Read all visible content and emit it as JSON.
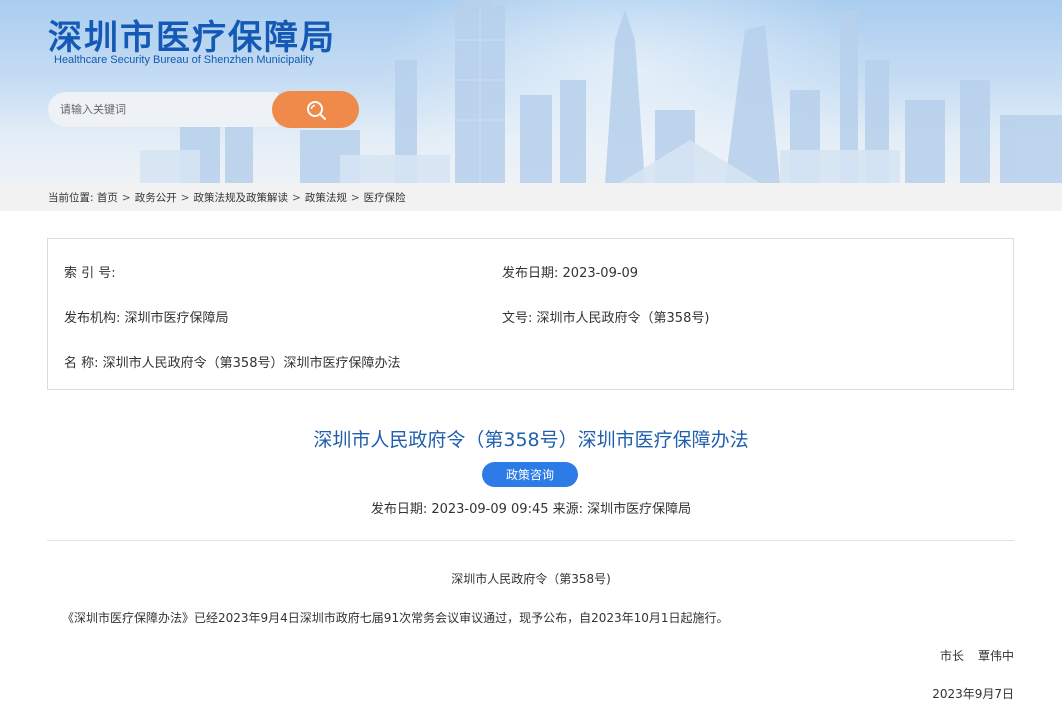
{
  "header": {
    "title": "深圳市医疗保障局",
    "subtitle": "Healthcare Security Bureau of Shenzhen Municipality",
    "search_placeholder": "请输入关键词"
  },
  "breadcrumb": {
    "prefix": "当前位置:",
    "items": [
      "首页",
      "政务公开",
      "政策法规及政策解读",
      "政策法规",
      "医疗保险"
    ],
    "separator": ">"
  },
  "info": {
    "index_label": "索 引 号:",
    "index_value": "",
    "date_label": "发布日期:",
    "date_value": "2023-09-09",
    "org_label": "发布机构:",
    "org_value": "深圳市医疗保障局",
    "doc_no_label": "文号:",
    "doc_no_value": "深圳市人民政府令（第358号)",
    "name_label": "名 称:",
    "name_value": "深圳市人民政府令（第358号）深圳市医疗保障办法"
  },
  "article": {
    "title": "深圳市人民政府令（第358号）深圳市医疗保障办法",
    "tag_button": "政策咨询",
    "meta_date_label": "发布日期:",
    "meta_date_value": "2023-09-09 09:45",
    "meta_source_label": "来源:",
    "meta_source_value": "深圳市医疗保障局",
    "decree_heading": "深圳市人民政府令（第358号)",
    "decree_text": "《深圳市医疗保障办法》已经2023年9月4日深圳市政府七届91次常务会议审议通过，现予公布，自2023年10月1日起施行。",
    "signer_title": "市长",
    "signer_name": "覃伟中",
    "sign_date": "2023年9月7日"
  },
  "colors": {
    "brand_blue": "#1359b5",
    "title_blue": "#1f5fae",
    "search_orange": "#ef8a4a",
    "tag_blue": "#2d7be6"
  },
  "icons": {
    "search_button": "search-icon"
  }
}
